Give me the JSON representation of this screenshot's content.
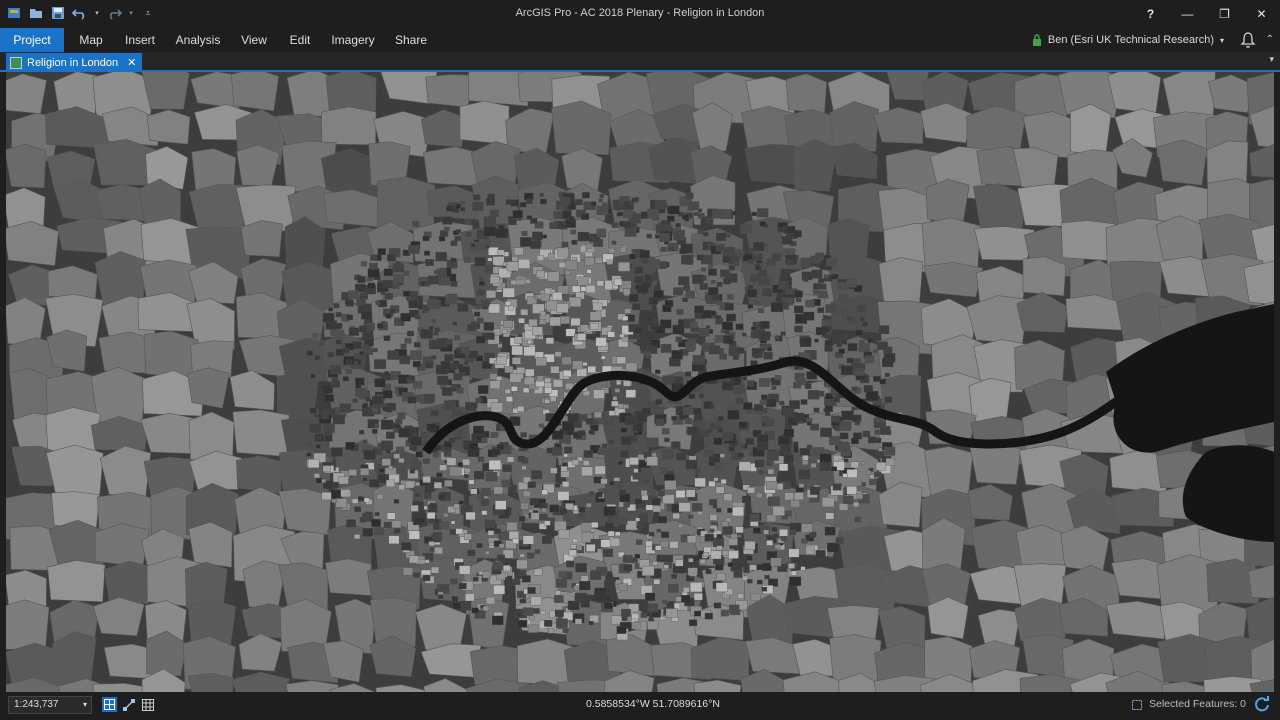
{
  "window": {
    "title": "ArcGIS Pro - AC 2018 Plenary - Religion in London",
    "controls": {
      "help": "?",
      "minimize": "—",
      "restore": "❐",
      "close": "✕"
    }
  },
  "quick_access": [
    "new-project-icon",
    "open-folder-icon",
    "save-icon",
    "undo-icon",
    "redo-icon",
    "customize-icon"
  ],
  "ribbon": {
    "tabs": [
      {
        "label": "Project"
      },
      {
        "label": "Map"
      },
      {
        "label": "Insert"
      },
      {
        "label": "Analysis"
      },
      {
        "label": "View"
      },
      {
        "label": "Edit"
      },
      {
        "label": "Imagery"
      },
      {
        "label": "Share"
      }
    ],
    "user": "Ben (Esri UK Technical Research)",
    "accent": "#1a73c9"
  },
  "document": {
    "tab_label": "Religion in London",
    "close": "✕"
  },
  "map": {
    "basemap_dark": "#2c2c2c",
    "polygon_light": "#9a9a9a",
    "water": "#141414"
  },
  "status": {
    "scale": "1:243,737",
    "coordinates": "0.5858534°W 51.7089616°N",
    "selected_features": "Selected Features: 0"
  }
}
